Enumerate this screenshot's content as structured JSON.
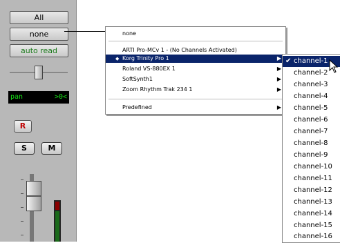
{
  "strip": {
    "all_label": "All",
    "none_label": "none",
    "automation_label": "auto read",
    "pan_label": "pan",
    "pan_value": ">0<",
    "record_label": "R",
    "solo_label": "S",
    "mute_label": "M"
  },
  "menu": {
    "top_item": "none",
    "items": [
      {
        "label": "ARTI Pro-MCv 1 - (No Channels Activated)",
        "highlighted": false,
        "submenu": false
      },
      {
        "label": "Korg Trinity Pro 1",
        "highlighted": true,
        "submenu": true
      },
      {
        "label": "Roland VS-880EX 1",
        "highlighted": false,
        "submenu": true
      },
      {
        "label": "SoftSynth1",
        "highlighted": false,
        "submenu": true
      },
      {
        "label": "Zoom Rhythm Trak 234 1",
        "highlighted": false,
        "submenu": true
      }
    ],
    "predefined": "Predefined"
  },
  "submenu": {
    "channels": [
      "channel-1",
      "channel-2",
      "channel-3",
      "channel-4",
      "channel-5",
      "channel-6",
      "channel-7",
      "channel-8",
      "channel-9",
      "channel-10",
      "channel-11",
      "channel-12",
      "channel-13",
      "channel-14",
      "channel-15",
      "channel-16"
    ],
    "checked": "channel-1"
  },
  "icons": {
    "bullet": "bullet-icon",
    "arrow": "submenu-arrow-icon",
    "check": "checkmark-icon",
    "cursor": "mouse-pointer-icon"
  },
  "colors": {
    "highlight": "#0a246a",
    "pan_text": "#18e018",
    "automation_text": "#1a7a1a",
    "record_text": "#c00000"
  }
}
